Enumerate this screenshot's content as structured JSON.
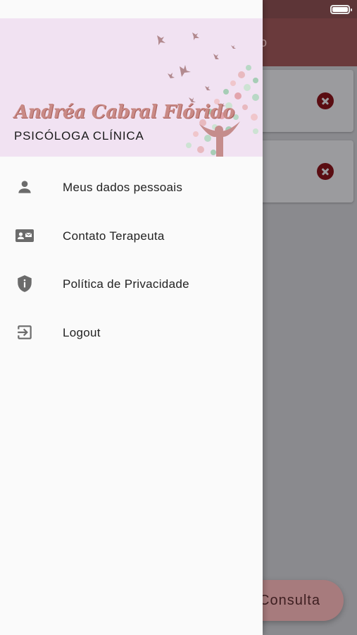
{
  "background_app": {
    "header_title_fragment": "o",
    "fab_label": "Consulta"
  },
  "drawer": {
    "brand": {
      "name": "Andréa Cabral Flórido",
      "subtitle": "PSICÓLOGA CLÍNICA"
    },
    "menu": [
      {
        "label": "Meus dados pessoais",
        "icon": "person-icon"
      },
      {
        "label": "Contato Terapeuta",
        "icon": "contact-card-icon"
      },
      {
        "label": "Política de Privacidade",
        "icon": "shield-info-icon"
      },
      {
        "label": "Logout",
        "icon": "logout-icon"
      }
    ]
  },
  "colors": {
    "header_bg": "#f1e2f2",
    "brand_text": "#c98a86",
    "app_header": "#6a3a3c",
    "delete_icon": "#5a0d12"
  }
}
